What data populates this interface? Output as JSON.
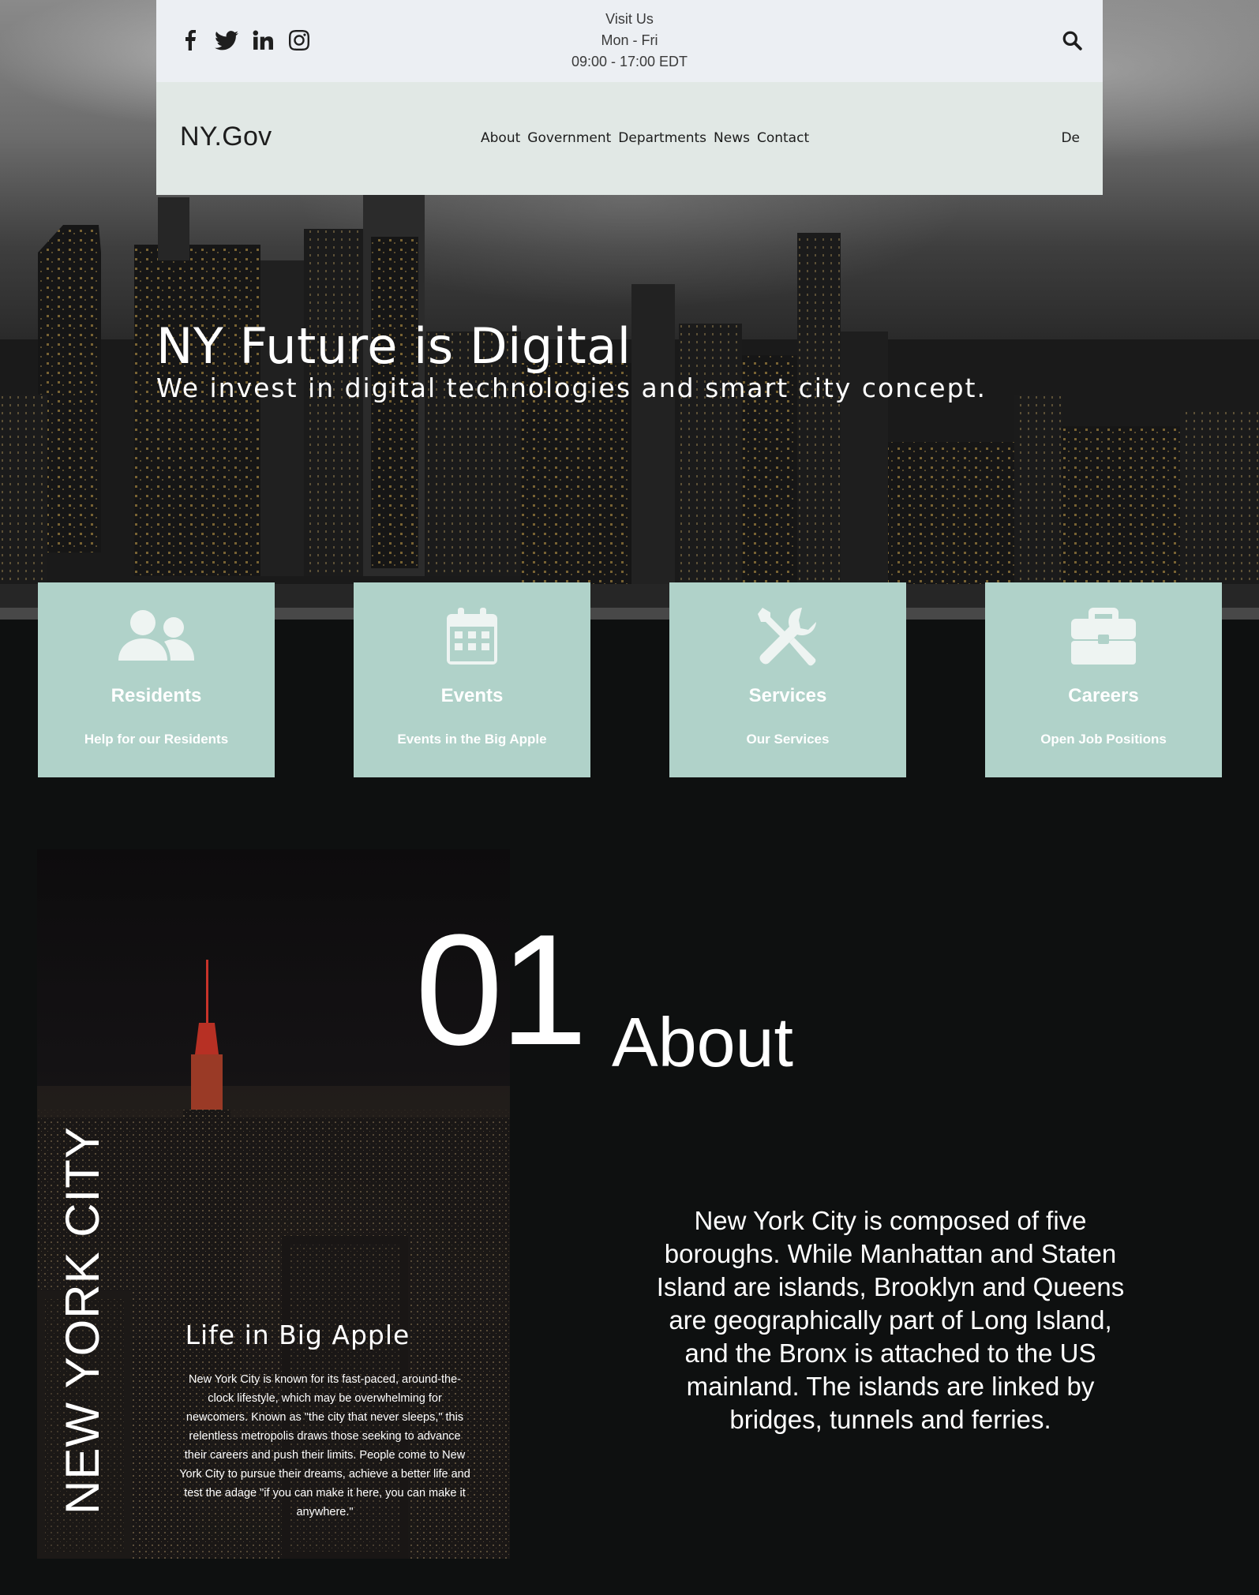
{
  "topbar": {
    "visit_title": "Visit Us",
    "visit_days": "Mon - Fri",
    "visit_hours": "09:00 - 17:00 EDT",
    "social_icons": [
      "facebook-icon",
      "twitter-icon",
      "linkedin-icon",
      "instagram-icon"
    ],
    "search_icon": "search-icon"
  },
  "navbar": {
    "logo": "NY.Gov",
    "links": [
      "About",
      "Government",
      "Departments",
      "News",
      "Contact"
    ],
    "language": "De"
  },
  "hero": {
    "title": "NY Future is Digital",
    "subtitle": "We invest in digital technologies and smart city concept."
  },
  "cards": [
    {
      "title": "Residents",
      "desc": "Help for our Residents",
      "icon": "users-icon"
    },
    {
      "title": "Events",
      "desc": "Events in the Big Apple",
      "icon": "calendar-icon"
    },
    {
      "title": "Services",
      "desc": "Our Services",
      "icon": "tools-icon"
    },
    {
      "title": "Careers",
      "desc": "Open Job Positions",
      "icon": "briefcase-icon"
    }
  ],
  "about": {
    "vertical_label": "NEW YORK CITY",
    "panel_title": "Life in Big Apple",
    "panel_text": "New York City is known for its fast-paced, around-the-clock lifestyle, which may be overwhelming for newcomers. Known as \"the city that never sleeps,\" this relentless metropolis draws those seeking to advance their careers and push their limits. People come to New York City to pursue their dreams, achieve a better life and test the adage \"if you can make it here, you can make it anywhere.\"",
    "number": "01",
    "heading": "About",
    "paragraph": "New York City is composed of five boroughs. While Manhattan and Staten Island are islands, Brooklyn and Queens are geographically part of Long Island, and the Bronx is attached to the US mainland. The islands are linked by bridges, tunnels and ferries."
  },
  "colors": {
    "topbar_bg": "#eceff3",
    "navbar_bg": "#e1e8e5",
    "card_bg": "#b0d2c9",
    "page_bg": "#0e1010"
  }
}
